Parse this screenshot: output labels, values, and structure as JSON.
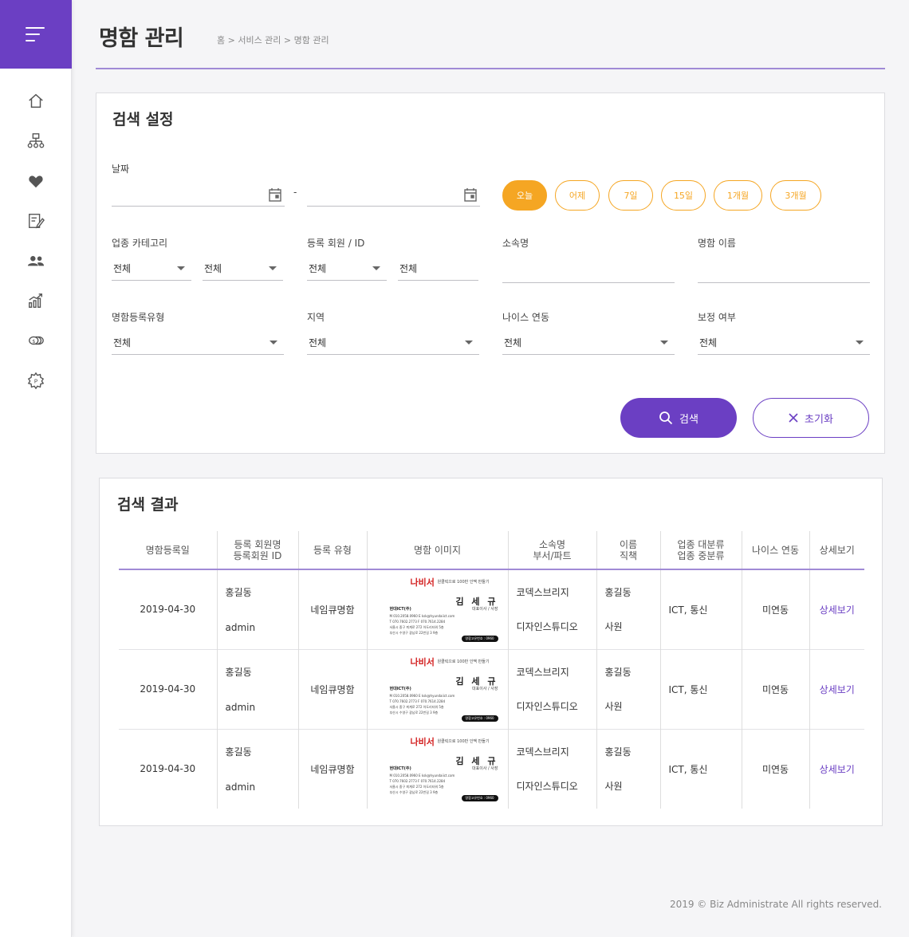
{
  "header": {
    "title": "명함 관리",
    "breadcrumb": "홈 > 서비스 관리 > 명함 관리"
  },
  "sidebar": {
    "icons": [
      "home-icon",
      "sitemap-icon",
      "heart-icon",
      "edit-note-icon",
      "users-icon",
      "chart-icon",
      "coins-icon",
      "settings-p-icon"
    ]
  },
  "search": {
    "title": "검색 설정",
    "date_label": "날짜",
    "date_separator": "-",
    "date_presets": [
      "오늘",
      "어제",
      "7일",
      "15일",
      "1개월",
      "3개월"
    ],
    "category_label": "업종 카테고리",
    "category_main": "전체",
    "category_sub": "전체",
    "member_label": "등록 회원 / ID",
    "member_select": "전체",
    "member_input": "전체",
    "org_label": "소속명",
    "org_value": "",
    "cardname_label": "명함 이름",
    "cardname_value": "",
    "regtype_label": "명함등록유형",
    "regtype_value": "전체",
    "region_label": "지역",
    "region_value": "전체",
    "nice_label": "나이스 연동",
    "nice_value": "전체",
    "correction_label": "보정 여부",
    "correction_value": "전체",
    "search_button": "검색",
    "reset_button": "초기화"
  },
  "results": {
    "title": "검색 결과",
    "columns": [
      {
        "line1": "명함등록일",
        "line2": ""
      },
      {
        "line1": "등록 회원명",
        "line2": "등록회원 ID"
      },
      {
        "line1": "등록 유형",
        "line2": ""
      },
      {
        "line1": "명함 이미지",
        "line2": ""
      },
      {
        "line1": "소속명",
        "line2": "부서/파트"
      },
      {
        "line1": "이름",
        "line2": "직책"
      },
      {
        "line1": "업종 대분류",
        "line2": "업종 중분류"
      },
      {
        "line1": "나이스 연동",
        "line2": ""
      },
      {
        "line1": "상세보기",
        "line2": ""
      }
    ],
    "rows": [
      {
        "date": "2019-04-30",
        "member_name": "홍길동",
        "member_id": "admin",
        "reg_type": "네임큐명함",
        "org": "코덱스브리지",
        "dept": "디자인스튜디오",
        "name": "홍길동",
        "position": "사원",
        "industry": "ICT, 통신",
        "nice": "미연동",
        "detail": "상세보기"
      },
      {
        "date": "2019-04-30",
        "member_name": "홍길동",
        "member_id": "admin",
        "reg_type": "네임큐명함",
        "org": "코덱스브리지",
        "dept": "디자인스튜디오",
        "name": "홍길동",
        "position": "사원",
        "industry": "ICT, 통신",
        "nice": "미연동",
        "detail": "상세보기"
      },
      {
        "date": "2019-04-30",
        "member_name": "홍길동",
        "member_id": "admin",
        "reg_type": "네임큐명함",
        "org": "코덱스브리지",
        "dept": "디자인스튜디오",
        "name": "홍길동",
        "position": "사원",
        "industry": "ICT, 통신",
        "nice": "미연동",
        "detail": "상세보기"
      }
    ]
  },
  "business_card": {
    "logo": "나비서",
    "slogan": "원클릭으로 100만 인맥 만들기",
    "name": "김 세 규",
    "role": "대표이사 / 사장",
    "company": "현대ICT(주)",
    "line1": "M 010.2058.0960    E ksk@hyundaiict.com",
    "line2": "T 070.7602.2773    F 070.7614.2284",
    "line3": "서울시 중구 퇴계로 272 아도리타워 5층",
    "line4": "부산시 수영구 광남로 22번길 3 9층",
    "badge": "명함고유번호 : 0960"
  },
  "footer": "2019 © Biz Administrate All rights reserved.",
  "colors": {
    "brand": "#6b3fc3",
    "accent": "#f5a623"
  }
}
